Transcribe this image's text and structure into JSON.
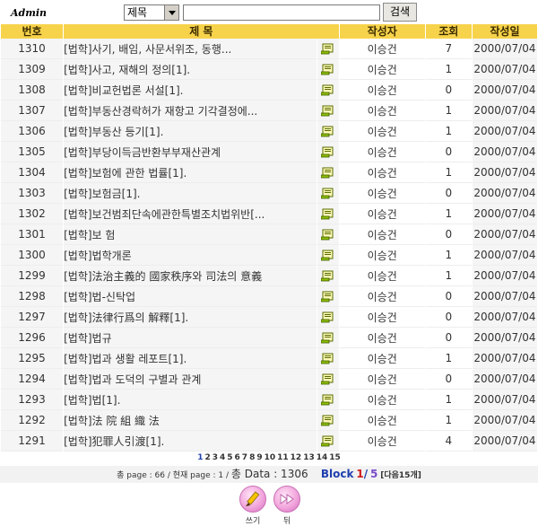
{
  "header": {
    "admin_label": "Admin",
    "search_select_value": "제목",
    "search_button": "검색"
  },
  "columns": {
    "number": "번호",
    "title": "제 목",
    "author": "작성자",
    "views": "조회",
    "date": "작성일"
  },
  "rows": [
    {
      "number": "1310",
      "title": "[법학]사기, 배임, 사문서위조, 동행...",
      "author": "이승건",
      "views": "7",
      "date": "2000/07/04"
    },
    {
      "number": "1309",
      "title": "[법학]사고, 재해의 정의[1].",
      "author": "이승건",
      "views": "1",
      "date": "2000/07/04"
    },
    {
      "number": "1308",
      "title": "[법학]비교헌법론 서설[1].",
      "author": "이승건",
      "views": "0",
      "date": "2000/07/04"
    },
    {
      "number": "1307",
      "title": "[법학]부동산경락허가 재항고 기각결정에...",
      "author": "이승건",
      "views": "1",
      "date": "2000/07/04"
    },
    {
      "number": "1306",
      "title": "[법학]부동산 등기[1].",
      "author": "이승건",
      "views": "1",
      "date": "2000/07/04"
    },
    {
      "number": "1305",
      "title": "[법학]부당이득금반환부부재산관계",
      "author": "이승건",
      "views": "0",
      "date": "2000/07/04"
    },
    {
      "number": "1304",
      "title": "[법학]보험에 관한 법률[1].",
      "author": "이승건",
      "views": "1",
      "date": "2000/07/04"
    },
    {
      "number": "1303",
      "title": "[법학]보험금[1].",
      "author": "이승건",
      "views": "0",
      "date": "2000/07/04"
    },
    {
      "number": "1302",
      "title": "[법학]보건범죄단속에관한특별조치법위반[...",
      "author": "이승건",
      "views": "1",
      "date": "2000/07/04"
    },
    {
      "number": "1301",
      "title": "[법학]보 험",
      "author": "이승건",
      "views": "0",
      "date": "2000/07/04"
    },
    {
      "number": "1300",
      "title": "[법학]법학개론",
      "author": "이승건",
      "views": "1",
      "date": "2000/07/04"
    },
    {
      "number": "1299",
      "title": "[법학]法治主義的 國家秩序와 司法의 意義",
      "author": "이승건",
      "views": "1",
      "date": "2000/07/04"
    },
    {
      "number": "1298",
      "title": "[법학]법-신탁업",
      "author": "이승건",
      "views": "0",
      "date": "2000/07/04"
    },
    {
      "number": "1297",
      "title": "[법학]法律行爲의 解釋[1].",
      "author": "이승건",
      "views": "0",
      "date": "2000/07/04"
    },
    {
      "number": "1296",
      "title": "[법학]법규",
      "author": "이승건",
      "views": "0",
      "date": "2000/07/04"
    },
    {
      "number": "1295",
      "title": "[법학]법과 생활 레포트[1].",
      "author": "이승건",
      "views": "1",
      "date": "2000/07/04"
    },
    {
      "number": "1294",
      "title": "[법학]법과 도덕의 구별과 관계",
      "author": "이승건",
      "views": "0",
      "date": "2000/07/04"
    },
    {
      "number": "1293",
      "title": "[법학]법[1].",
      "author": "이승건",
      "views": "1",
      "date": "2000/07/04"
    },
    {
      "number": "1292",
      "title": "[법학]法 院 組 織 法",
      "author": "이승건",
      "views": "1",
      "date": "2000/07/04"
    },
    {
      "number": "1291",
      "title": "[법학]犯罪人引渡[1].",
      "author": "이승건",
      "views": "4",
      "date": "2000/07/04"
    }
  ],
  "pagination": {
    "pages": [
      "1",
      "2",
      "3",
      "4",
      "5",
      "6",
      "7",
      "8",
      "9",
      "10",
      "11",
      "12",
      "13",
      "14",
      "15"
    ],
    "current": "1"
  },
  "info": {
    "total_pages": "총 page : 66 / 현재 page : 1 / ",
    "total_data": "총 Data : 1306",
    "block_label": "Block",
    "block_current": "1",
    "block_sep": "/",
    "block_max": "5",
    "next_label": "[다음15개]"
  },
  "buttons": {
    "write_label": "쓰기",
    "back_label": "뒤"
  },
  "colors": {
    "header_bg": "#f7d34b",
    "accent_blue": "#1f3fae",
    "accent_red": "#d01b1b",
    "accent_purple": "#7a4cc9",
    "button_pink": "#f2a6dc"
  }
}
